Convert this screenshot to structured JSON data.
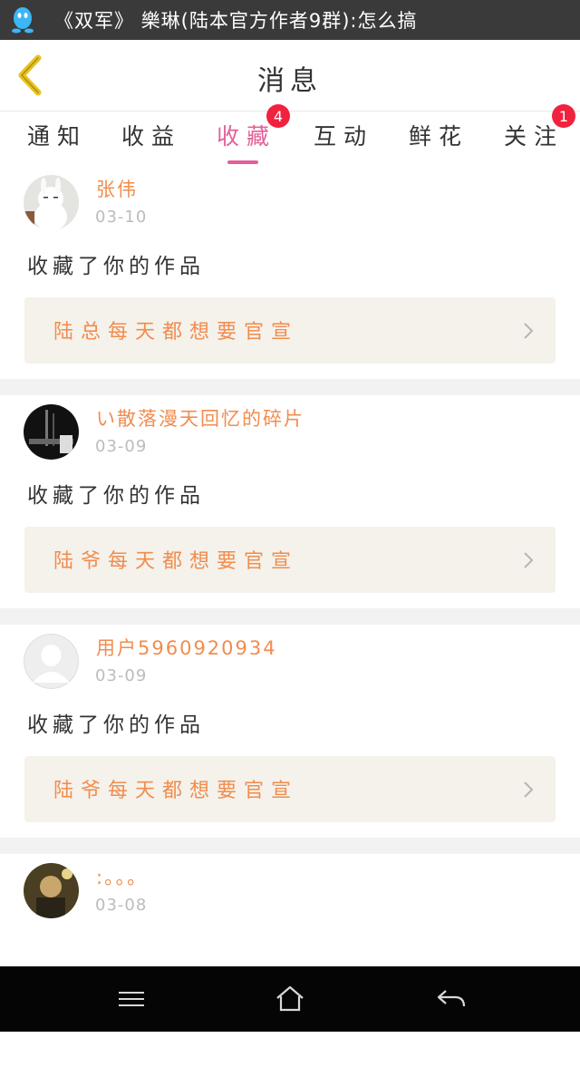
{
  "status_bar": {
    "app_icon": "qq-penguin-icon",
    "notification_text": "《双军》 樂琳(陆本官方作者9群):怎么搞"
  },
  "header": {
    "back_icon": "back-chevron-icon",
    "title": "消息",
    "accent_color": "#e8c21f"
  },
  "tabs": [
    {
      "label": "通知",
      "active": false
    },
    {
      "label": "收益",
      "active": false
    },
    {
      "label": "收藏",
      "active": true,
      "badge": "4"
    },
    {
      "label": "互动",
      "active": false
    },
    {
      "label": "鲜花",
      "active": false
    },
    {
      "label": "关注",
      "active": false,
      "badge": "1"
    }
  ],
  "colors": {
    "active_tab": "#e45f99",
    "badge": "#f0223e",
    "username": "#f28c4e",
    "work_link_bg": "#f4f2eb"
  },
  "messages": [
    {
      "username": "张伟",
      "date": "03-10",
      "action": "收藏了你的作品",
      "work_title": "陆总每天都想要官宣",
      "avatar": "rabbit-avatar"
    },
    {
      "username": "い散落漫天回忆的碎片",
      "date": "03-09",
      "action": "收藏了你的作品",
      "work_title": "陆爷每天都想要官宣",
      "avatar": "dark-photo-avatar"
    },
    {
      "username": "用户5960920934",
      "date": "03-09",
      "action": "收藏了你的作品",
      "work_title": "陆爷每天都想要官宣",
      "avatar": "default-user-avatar"
    },
    {
      "username": ":。。。",
      "date": "03-08",
      "avatar": "photo-avatar"
    }
  ],
  "nav_bar": {
    "menu_icon": "menu-icon",
    "home_icon": "home-icon",
    "back_icon": "back-arrow-icon"
  }
}
